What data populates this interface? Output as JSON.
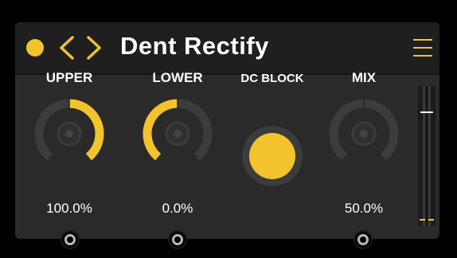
{
  "plugin": {
    "title": "Dent Rectify"
  },
  "colors": {
    "accent": "#f2c32c",
    "panel": "#2a2a2a",
    "header": "#1f1f1f",
    "knob_track": "#3c3c3c",
    "text": "#ffffff"
  },
  "controls": {
    "upper": {
      "label": "UPPER",
      "value": "100.0%",
      "level": 1.0
    },
    "lower": {
      "label": "LOWER",
      "value": "0.0%",
      "level": 0.0
    },
    "dc_block": {
      "label": "DC BLOCK",
      "state": "on"
    },
    "mix": {
      "label": "MIX",
      "value": "50.0%",
      "level": 0.5
    }
  },
  "meter": {
    "handle_level": 0.82,
    "signal_level": 0.04
  },
  "icons": {
    "power": "power-dot-icon",
    "prev": "chevron-left-icon",
    "next": "chevron-right-icon",
    "menu": "hamburger-menu-icon"
  }
}
